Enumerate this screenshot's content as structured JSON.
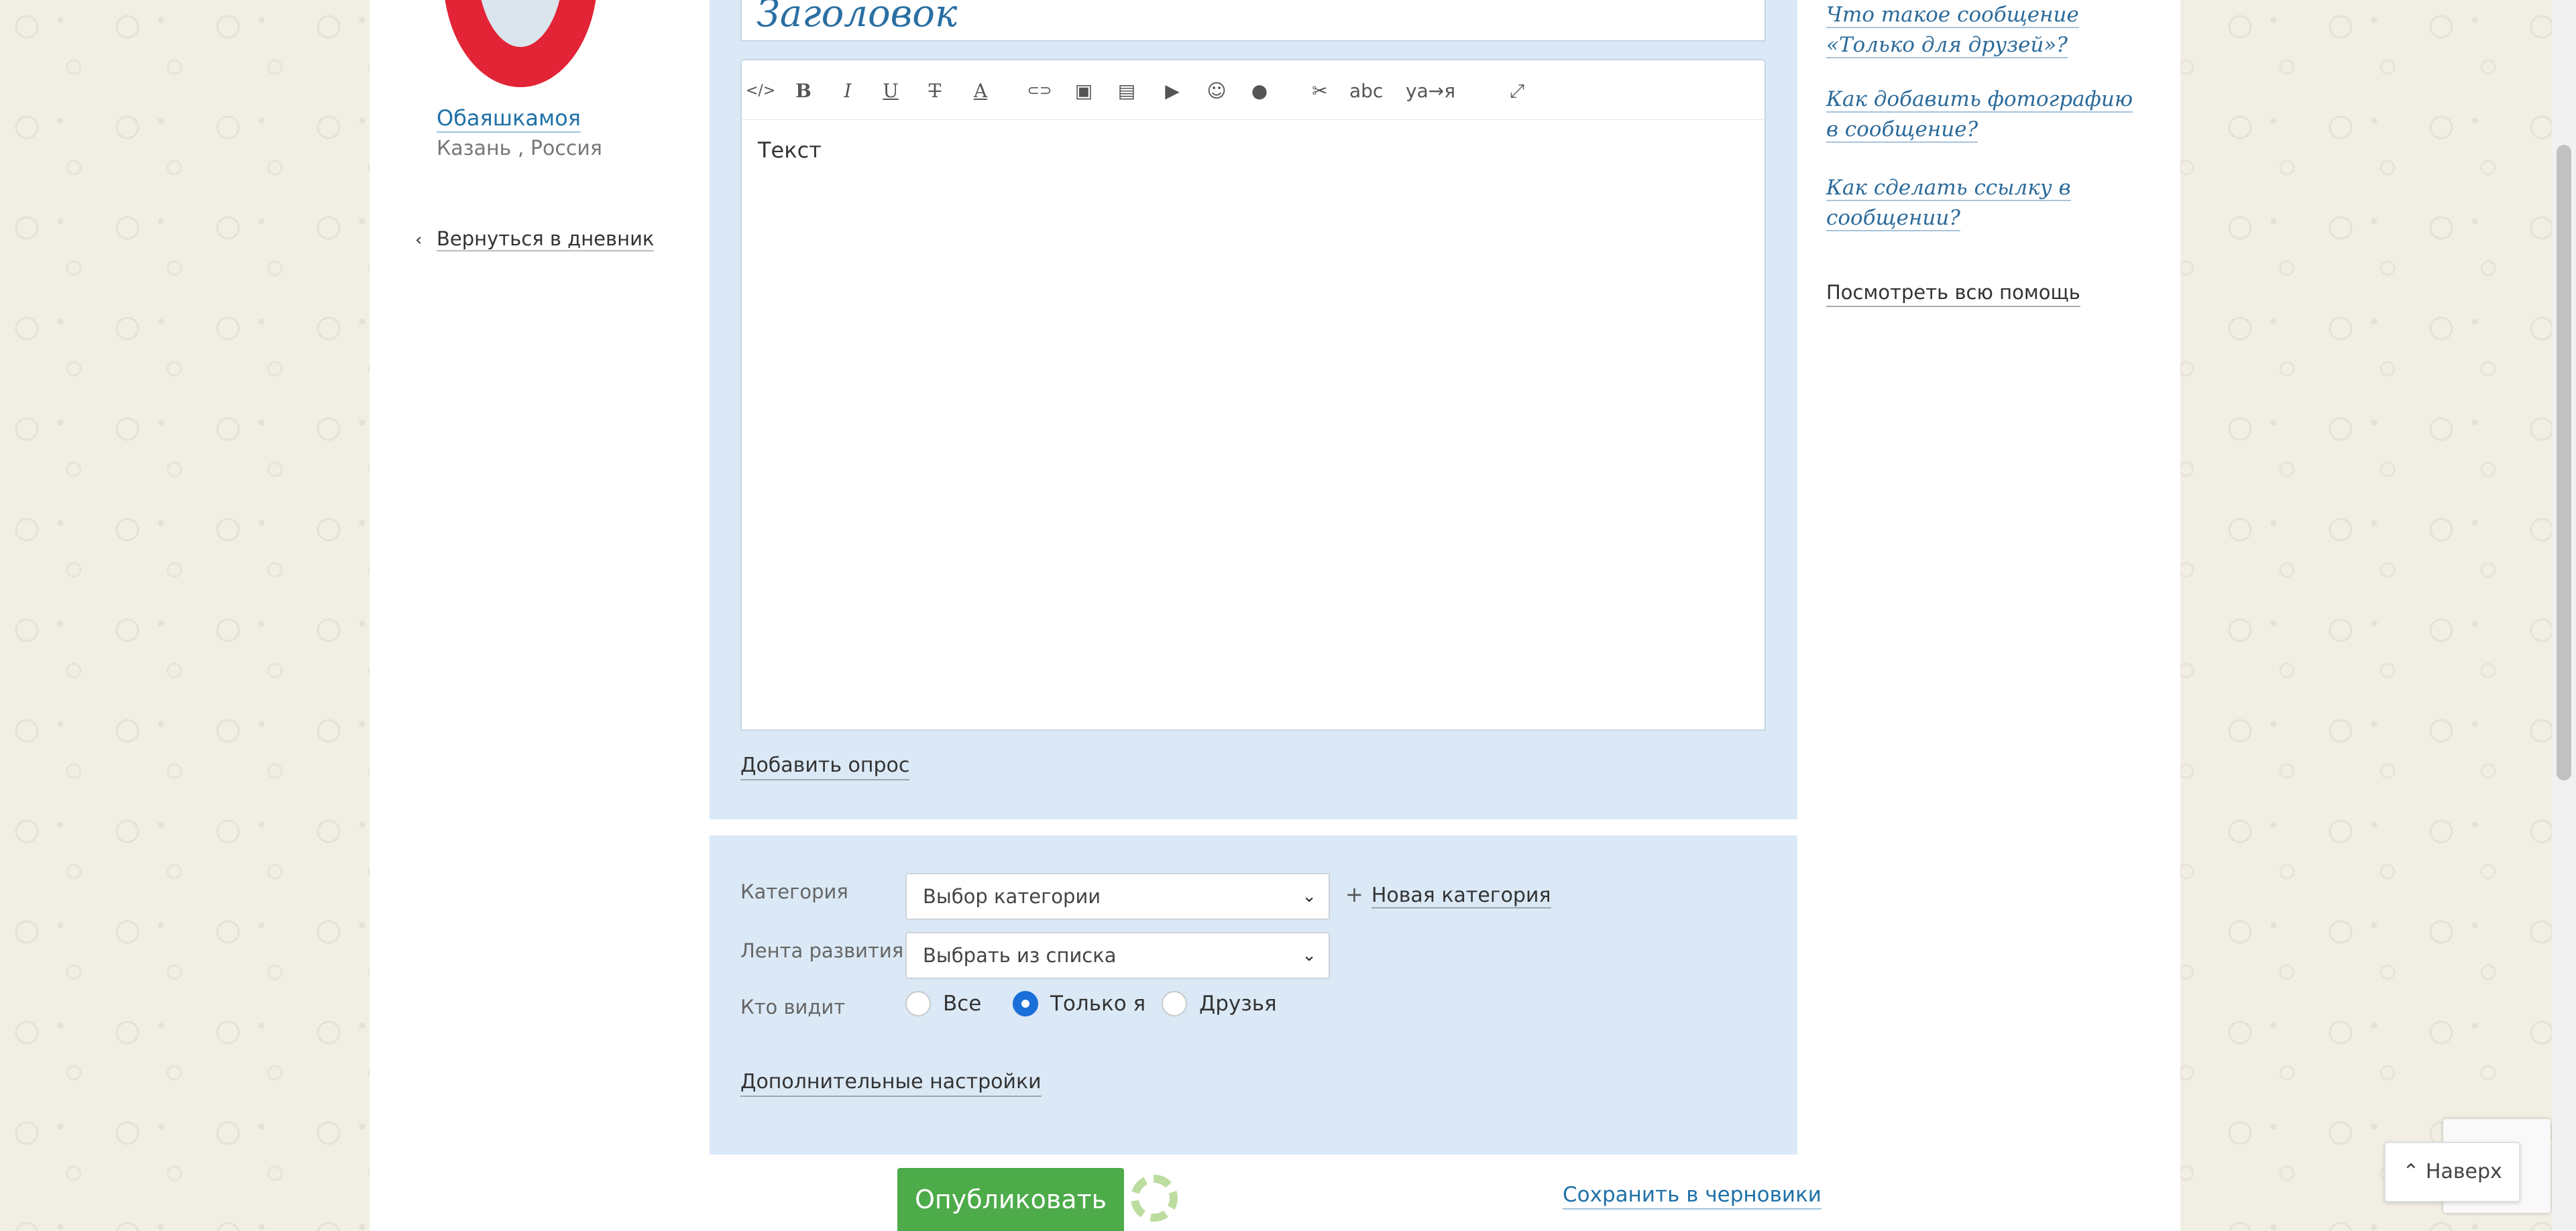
{
  "profile": {
    "name": "Обаяшкамоя",
    "location": "Казань , Россия"
  },
  "nav": {
    "back_label": "Вернуться в дневник"
  },
  "editor": {
    "title_placeholder": "Заголовок",
    "text_placeholder": "Текст",
    "add_poll_label": "Добавить опрос",
    "toolbar": [
      {
        "icon": "html-code-icon",
        "glyph": "</>"
      },
      {
        "icon": "bold-icon",
        "glyph": "B"
      },
      {
        "icon": "italic-icon",
        "glyph": "I"
      },
      {
        "icon": "underline-icon",
        "glyph": "U"
      },
      {
        "icon": "strikethrough-icon",
        "glyph": "T"
      },
      {
        "icon": "text-color-icon",
        "glyph": "A"
      },
      {
        "icon": "link-icon",
        "glyph": "⊂⊃"
      },
      {
        "icon": "image-icon",
        "glyph": "▣"
      },
      {
        "icon": "gallery-icon",
        "glyph": "▤"
      },
      {
        "icon": "video-icon",
        "glyph": "▶"
      },
      {
        "icon": "emoji-icon",
        "glyph": "☺"
      },
      {
        "icon": "user-mention-icon",
        "glyph": "●"
      },
      {
        "icon": "cut-icon",
        "glyph": "✂"
      },
      {
        "icon": "spellcheck-icon",
        "glyph": "abc"
      },
      {
        "icon": "transliteration-icon",
        "glyph": "ya→я"
      },
      {
        "icon": "fullscreen-icon",
        "glyph": "⤢"
      }
    ]
  },
  "settings": {
    "category_label": "Категория",
    "category_value": "Выбор категории",
    "new_category_label": "Новая категория",
    "feed_label": "Лента развития",
    "feed_value": "Выбрать из списка",
    "visibility_label": "Кто видит",
    "visibility_options": [
      "Все",
      "Только я",
      "Друзья"
    ],
    "visibility_selected": "Только я",
    "extra_label": "Дополнительные настройки"
  },
  "actions": {
    "publish_label": "Опубликовать",
    "draft_label": "Сохранить в черновики"
  },
  "help": {
    "links": [
      "Что такое сообщение «Только для друзей»?",
      "Как добавить фотографию в сообщение?",
      "Как сделать ссылку в сообщении?"
    ],
    "all_label": "Посмотреть всю помощь"
  },
  "totop_label": "Наверх",
  "colors": {
    "publish": "#4dab4a",
    "panel": "#dbe9f6",
    "link": "#2071a8",
    "radio_selected": "#1a6fd9"
  }
}
